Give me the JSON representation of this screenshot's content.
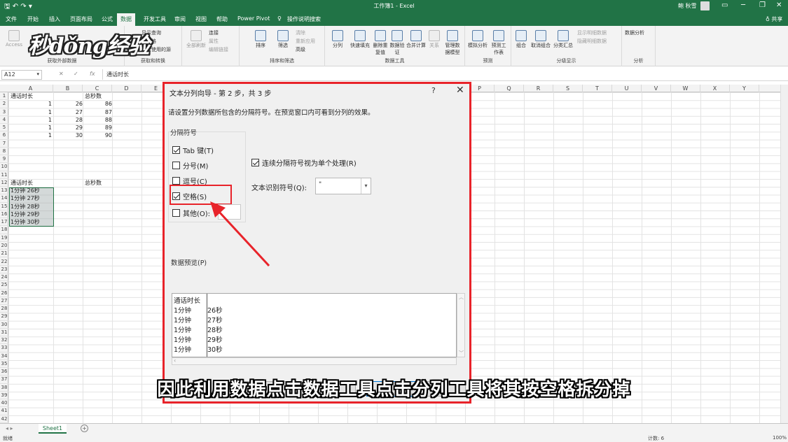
{
  "titlebar": {
    "title": "工作簿1 - Excel",
    "user": "鲍 秋雪",
    "quick_access": "🖫 ↶ ↷ ▾"
  },
  "tabs": [
    "文件",
    "开始",
    "插入",
    "页面布局",
    "公式",
    "数据",
    "开发工具",
    "审阅",
    "视图",
    "帮助",
    "Power Pivot",
    "操作说明搜索"
  ],
  "active_tab": "数据",
  "share": "♁ 共享",
  "ribbon": {
    "access": "Access",
    "get_data": {
      "show_query": "显示查询",
      "from_table": "从表格",
      "recent": "最近使用的源",
      "new_query": "新建查询",
      "label": "获取外部数据",
      "label2": "获取和转换"
    },
    "connections": {
      "refresh_all": "全部刷新",
      "connections": "连接",
      "properties": "属性",
      "edit_links": "编辑链接",
      "label": "连接"
    },
    "sort": {
      "sort": "排序",
      "filter": "筛选",
      "clear": "清除",
      "reapply": "重新应用",
      "advanced": "高级",
      "label": "排序和筛选"
    },
    "tools": {
      "text_to_columns": "分列",
      "flash_fill": "快速填充",
      "remove_dup": "删除重复值",
      "validation": "数据验证",
      "consolidate": "合并计算",
      "relations": "关系",
      "manage_model": "管理数据模型",
      "label": "数据工具"
    },
    "forecast": {
      "what_if": "模拟分析",
      "sheet": "预测工作表",
      "label": "预测"
    },
    "outline": {
      "group": "组合",
      "ungroup": "取消组合",
      "subtotal": "分类汇总",
      "show_detail": "显示明细数据",
      "hide_detail": "隐藏明细数据",
      "label": "分级显示"
    },
    "analysis": {
      "data_analysis": "数据分析",
      "label": "分析"
    }
  },
  "watermark": "秒dǒng经验",
  "formula_bar": {
    "name_box": "A12",
    "fx": "fx",
    "value": "通话时长"
  },
  "columns": [
    "A",
    "B",
    "C",
    "D",
    "E",
    "F",
    "G",
    "H",
    "I",
    "J",
    "K",
    "L",
    "M",
    "N",
    "O",
    "P",
    "Q",
    "R",
    "S",
    "T",
    "U",
    "V",
    "W",
    "X",
    "Y"
  ],
  "rows": [
    "1",
    "2",
    "3",
    "4",
    "5",
    "6",
    "7",
    "8",
    "9",
    "10",
    "11",
    "12",
    "13",
    "14",
    "15",
    "16",
    "17",
    "18",
    "19",
    "20",
    "21",
    "22",
    "23",
    "24",
    "25",
    "26",
    "27",
    "28",
    "29",
    "30",
    "31",
    "32",
    "33",
    "34",
    "35",
    "36",
    "37",
    "38",
    "39",
    "40",
    "41",
    "42"
  ],
  "cells": {
    "a1": "通话时长",
    "c1": "总秒数",
    "table1": [
      {
        "a": "1",
        "b": "26",
        "c": "86"
      },
      {
        "a": "1",
        "b": "27",
        "c": "87"
      },
      {
        "a": "1",
        "b": "28",
        "c": "88"
      },
      {
        "a": "1",
        "b": "29",
        "c": "89"
      },
      {
        "a": "1",
        "b": "30",
        "c": "90"
      }
    ],
    "a12": "通话时长",
    "c12": "总秒数",
    "table2": [
      "1分钟 26秒",
      "1分钟 27秒",
      "1分钟 28秒",
      "1分钟 29秒",
      "1分钟 30秒"
    ]
  },
  "sheet_tab": "Sheet1",
  "status": {
    "ready": "就绪",
    "count": "计数: 6",
    "zoom": "100%"
  },
  "dialog": {
    "title": "文本分列向导 - 第 2 步，共 3 步",
    "help": "?",
    "close": "✕",
    "description": "请设置分列数据所包含的分隔符号。在预览窗口内可看到分列的效果。",
    "delimiters_label": "分隔符号",
    "tab": "Tab 键(T)",
    "semicolon": "分号(M)",
    "comma": "逗号(C)",
    "space": "空格(S)",
    "other": "其他(O):",
    "consecutive": "连续分隔符号视为单个处理(R)",
    "qualifier_label": "文本识别符号(Q):",
    "qualifier_value": "\"",
    "preview_label": "数据预览(P)",
    "preview": [
      {
        "c1": "通话时长",
        "c2": ""
      },
      {
        "c1": "1分钟",
        "c2": "26秒"
      },
      {
        "c1": "1分钟",
        "c2": "27秒"
      },
      {
        "c1": "1分钟",
        "c2": "28秒"
      },
      {
        "c1": "1分钟",
        "c2": "29秒"
      },
      {
        "c1": "1分钟",
        "c2": "30秒"
      }
    ]
  },
  "caption": "因此利用数据点击数据工具点击分列工具将其按空格拆分掉",
  "colors": {
    "excel_green": "#217346",
    "highlight_red": "#e8232a"
  }
}
